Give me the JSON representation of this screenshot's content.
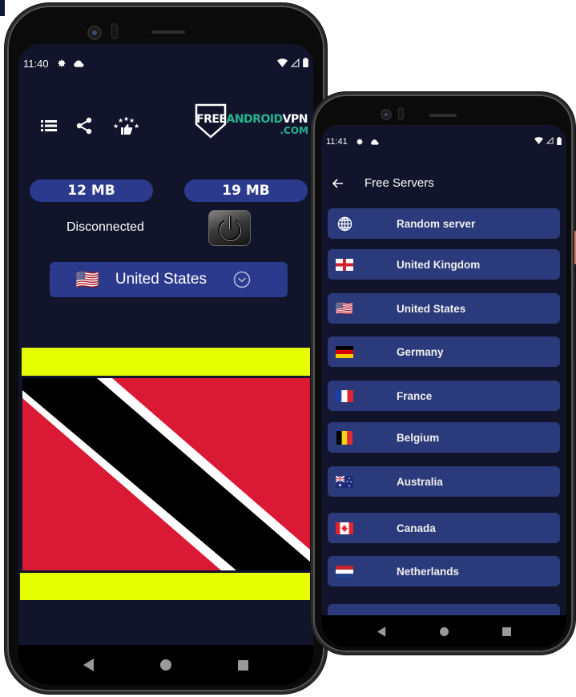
{
  "left_phone": {
    "status_bar": {
      "time": "11:40",
      "icons": [
        "settings-icon",
        "cloud-icon",
        "wifi-icon",
        "signal-icon",
        "battery-icon"
      ]
    },
    "toolbar": {
      "icons": [
        "list-icon",
        "share-icon",
        "rate-stars-icon"
      ]
    },
    "logo": {
      "part1": "FREE",
      "part2": "ANDROID",
      "part3": "VPN",
      "suffix": ".COM"
    },
    "stats": {
      "download": "12 MB",
      "upload": "19 MB"
    },
    "connection_status": "Disconnected",
    "selected_country": {
      "name": "United States",
      "flag": "🇺🇸"
    },
    "banner": {
      "flag": "Trinidad and Tobago"
    },
    "colors": {
      "background": "#11142a",
      "accent": "#2b3a8c",
      "banner_yellow": "#e6ff00",
      "logo_green": "#27b38f"
    }
  },
  "right_phone": {
    "status_bar": {
      "time": "11:41",
      "icons": [
        "settings-icon",
        "cloud-icon",
        "wifi-icon",
        "signal-icon",
        "battery-icon"
      ]
    },
    "header": {
      "title": "Free Servers"
    },
    "servers": [
      {
        "name": "Random server",
        "icon": "🌐"
      },
      {
        "name": "United Kingdom",
        "icon": "🏴"
      },
      {
        "name": "United States",
        "icon": "🇺🇸"
      },
      {
        "name": "Germany",
        "icon": "🇩🇪"
      },
      {
        "name": "France",
        "icon": "🇫🇷"
      },
      {
        "name": "Belgium",
        "icon": "🇧🇪"
      },
      {
        "name": "Australia",
        "icon": "🇦🇺"
      },
      {
        "name": "Canada",
        "icon": "🇨🇦"
      },
      {
        "name": "Netherlands",
        "icon": "🇳🇱"
      },
      {
        "name": "",
        "icon": ""
      }
    ]
  }
}
